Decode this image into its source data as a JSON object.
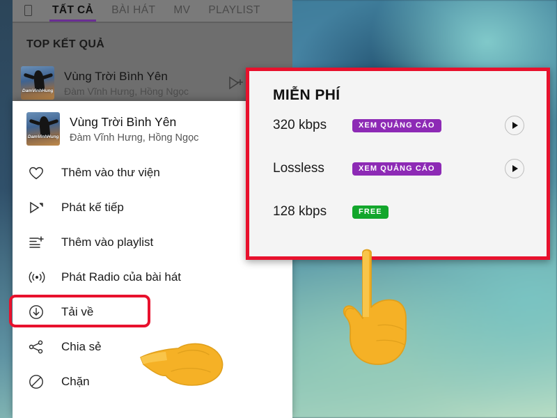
{
  "app": {
    "tabs": [
      {
        "label": "TẤT CẢ",
        "active": true
      },
      {
        "label": "BÀI HÁT",
        "active": false
      },
      {
        "label": "MV",
        "active": false
      },
      {
        "label": "PLAYLIST",
        "active": false
      }
    ],
    "section_label": "TOP KẾT QUẢ",
    "result": {
      "title": "Vùng Trời Bình Yên",
      "artists": "Đàm Vĩnh Hưng, Hồng Ngọc",
      "thumb_watermark": "DamVinhHung",
      "queue_icon": "add-to-queue-icon"
    },
    "accent_color": "#6a2e93"
  },
  "menu": {
    "song_title": "Vùng Trời Bình Yên",
    "song_artists": "Đàm Vĩnh Hưng, Hồng Ngọc",
    "thumb_watermark": "DamVinhHung",
    "items": [
      {
        "label": "Thêm vào thư viện",
        "icon": "heart-icon",
        "highlight": false
      },
      {
        "label": "Phát kế tiếp",
        "icon": "play-next-icon",
        "highlight": false
      },
      {
        "label": "Thêm vào playlist",
        "icon": "add-to-playlist-icon",
        "highlight": false
      },
      {
        "label": "Phát Radio của bài hát",
        "icon": "radio-icon",
        "highlight": false
      },
      {
        "label": "Tải về",
        "icon": "download-icon",
        "highlight": true
      },
      {
        "label": "Chia sẻ",
        "icon": "share-icon",
        "highlight": false
      },
      {
        "label": "Chặn",
        "icon": "block-icon",
        "highlight": false
      }
    ]
  },
  "quality_dialog": {
    "title": "MIỄN PHÍ",
    "rows": [
      {
        "name": "320 kbps",
        "badge": "XEM QUẢNG CÁO",
        "badge_type": "ads",
        "has_play": true
      },
      {
        "name": "Lossless",
        "badge": "XEM QUẢNG CÁO",
        "badge_type": "ads",
        "has_play": true
      },
      {
        "name": "128 kbps",
        "badge": "FREE",
        "badge_type": "free",
        "has_play": false
      }
    ],
    "colors": {
      "ads_badge": "#8d2ab5",
      "free_badge": "#12a62b",
      "highlight_border": "#e8112d"
    }
  },
  "annotations": {
    "pointer_menu": "pointing-hand-left-icon",
    "pointer_dialog": "pointing-hand-up-icon"
  }
}
